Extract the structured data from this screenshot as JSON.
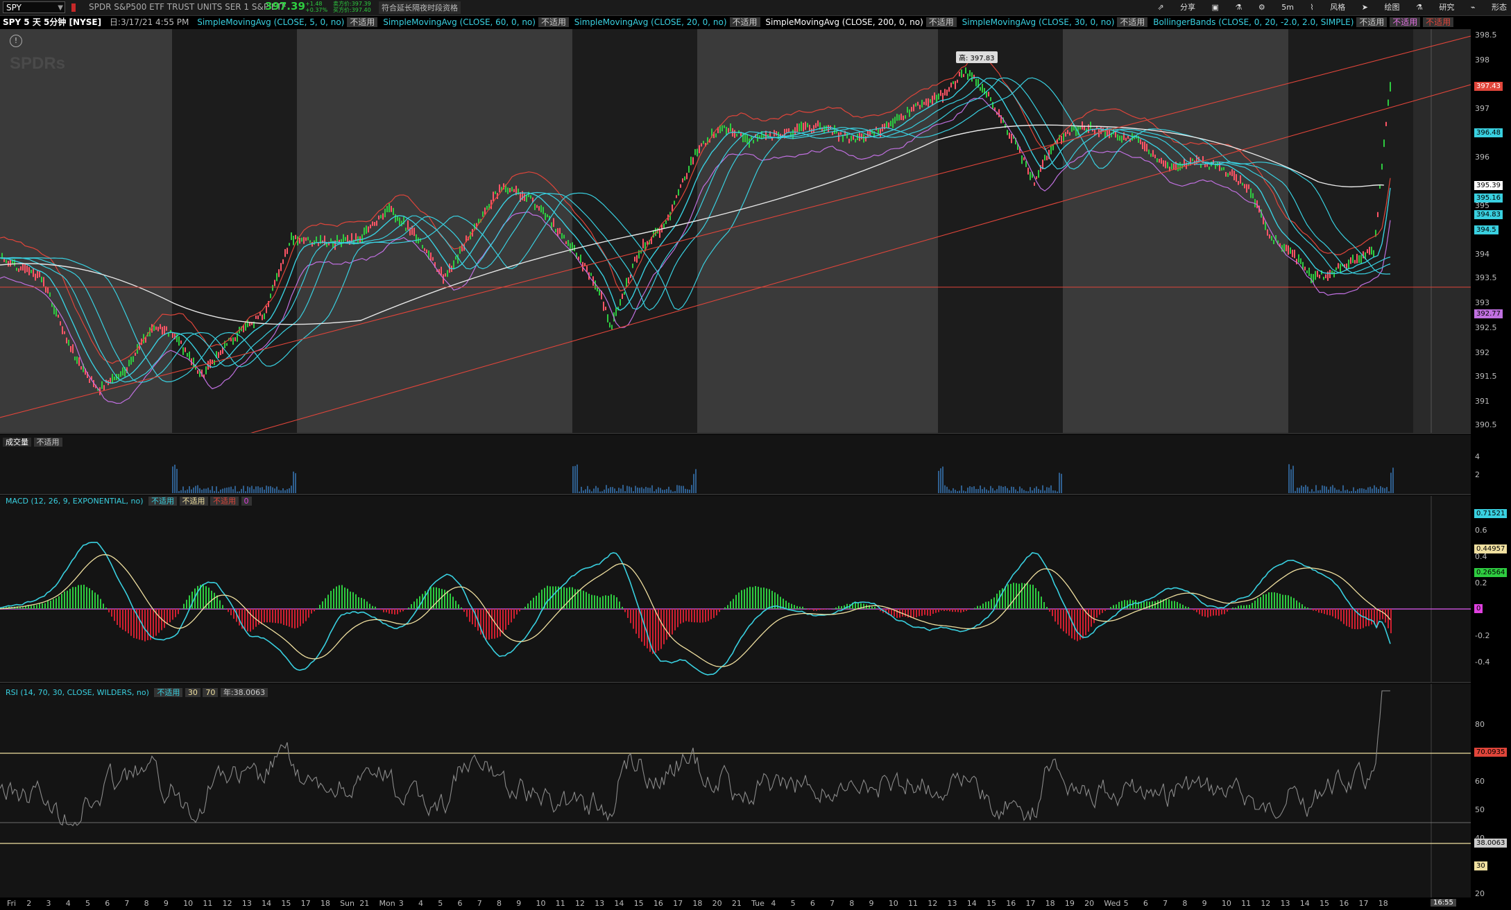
{
  "header": {
    "symbol": "SPY",
    "description": "SPDR S&P500 ETF TRUST UNITS SER 1 S&P ETF",
    "last_price": "397.39",
    "change": "+1.48",
    "change_pct": "+0.37%",
    "bid": "卖方价:397.39",
    "ask": "买方价:397.40",
    "ext_hours_label": "符合延长隔夜时段资格",
    "toolbar": [
      "分享",
      "",
      "",
      "",
      "5m",
      "风格",
      "绘图",
      "研究",
      "形态"
    ]
  },
  "studies": {
    "chart_title": "SPY 5 天 5分钟 [NYSE]",
    "date_readout": "日:3/17/21 4:55 PM",
    "items": [
      {
        "label": "SimpleMovingAvg (CLOSE, 5, 0, no)",
        "tag": "不适用",
        "color": "#39d0e0"
      },
      {
        "label": "SimpleMovingAvg (CLOSE, 60, 0, no)",
        "tag": "不适用",
        "color": "#39d0e0"
      },
      {
        "label": "SimpleMovingAvg (CLOSE, 20, 0, no)",
        "tag": "不适用",
        "color": "#39d0e0"
      },
      {
        "label": "SimpleMovingAvg (CLOSE, 200, 0, no)",
        "tag": "不适用",
        "color": "#ffffff"
      },
      {
        "label": "SimpleMovingAvg (CLOSE, 30, 0, no)",
        "tag": "不适用",
        "color": "#39d0e0"
      },
      {
        "label": "BollingerBands (CLOSE, 0, 20, -2.0, 2.0, SIMPLE)",
        "tag": "不适用",
        "color": "#39d0e0"
      }
    ],
    "extra_tags": [
      "不适用",
      "不适用"
    ]
  },
  "price_pane": {
    "axis_ticks": [
      "398.5",
      "398",
      "397",
      "396",
      "395",
      "394",
      "393.5",
      "393",
      "392.5",
      "392",
      "391.5",
      "391",
      "390.5"
    ],
    "high_label": "高: 397.83",
    "badges": [
      {
        "text": "397.43",
        "color": "#e0453a"
      },
      {
        "text": "396.48",
        "color": "#39d0e0"
      },
      {
        "text": "395.39",
        "color": "#ffffff"
      },
      {
        "text": "395.16",
        "color": "#39d0e0"
      },
      {
        "text": "394.83",
        "color": "#39d0e0"
      },
      {
        "text": "394.5",
        "color": "#39d0e0"
      },
      {
        "text": "392.77",
        "color": "#c070e0"
      }
    ]
  },
  "volume_pane": {
    "label": "成交量",
    "tag": "不适用",
    "ticks": [
      "4",
      "2"
    ]
  },
  "macd_pane": {
    "label": "MACD (12, 26, 9, EXPONENTIAL, no)",
    "tags": [
      "不适用",
      "不适用",
      "不适用",
      "0"
    ],
    "ticks": [
      "0.6",
      "0.4",
      "0.2",
      "-0.2",
      "-0.4"
    ],
    "badges": [
      {
        "text": "0.71521",
        "color": "#39d0e0"
      },
      {
        "text": "0.44957",
        "color": "#f0e0a0"
      },
      {
        "text": "0.26564",
        "color": "#2ecc40"
      },
      {
        "text": "0",
        "color": "#e040e0"
      }
    ]
  },
  "rsi_pane": {
    "label": "RSI (14, 70, 30, CLOSE, WILDERS, no)",
    "tags": [
      "不适用",
      "30",
      "70",
      "年:38.0063"
    ],
    "ticks": [
      "80",
      "60",
      "50",
      "40",
      "30",
      "20"
    ],
    "badges": [
      {
        "text": "70.0935",
        "color": "#e0453a"
      },
      {
        "text": "38.0063",
        "color": "#cccccc"
      },
      {
        "text": "30",
        "color": "#f0e0a0"
      }
    ]
  },
  "x_axis": {
    "labels": [
      "Fri",
      "2",
      "3",
      "4",
      "5",
      "6",
      "7",
      "8",
      "9",
      "10",
      "11",
      "12",
      "13",
      "14",
      "15",
      "17",
      "18",
      "Sun",
      "21",
      "Mon",
      "3",
      "4",
      "5",
      "6",
      "7",
      "8",
      "9",
      "10",
      "11",
      "12",
      "13",
      "14",
      "15",
      "16",
      "17",
      "18",
      "20",
      "21",
      "Tue",
      "4",
      "5",
      "6",
      "7",
      "8",
      "9",
      "10",
      "11",
      "12",
      "13",
      "14",
      "15",
      "16",
      "17",
      "18",
      "19",
      "20",
      "Wed",
      "5",
      "6",
      "7",
      "8",
      "9",
      "10",
      "11",
      "12",
      "13",
      "14",
      "15",
      "16",
      "17",
      "18"
    ],
    "time_box": "16:55"
  }
}
